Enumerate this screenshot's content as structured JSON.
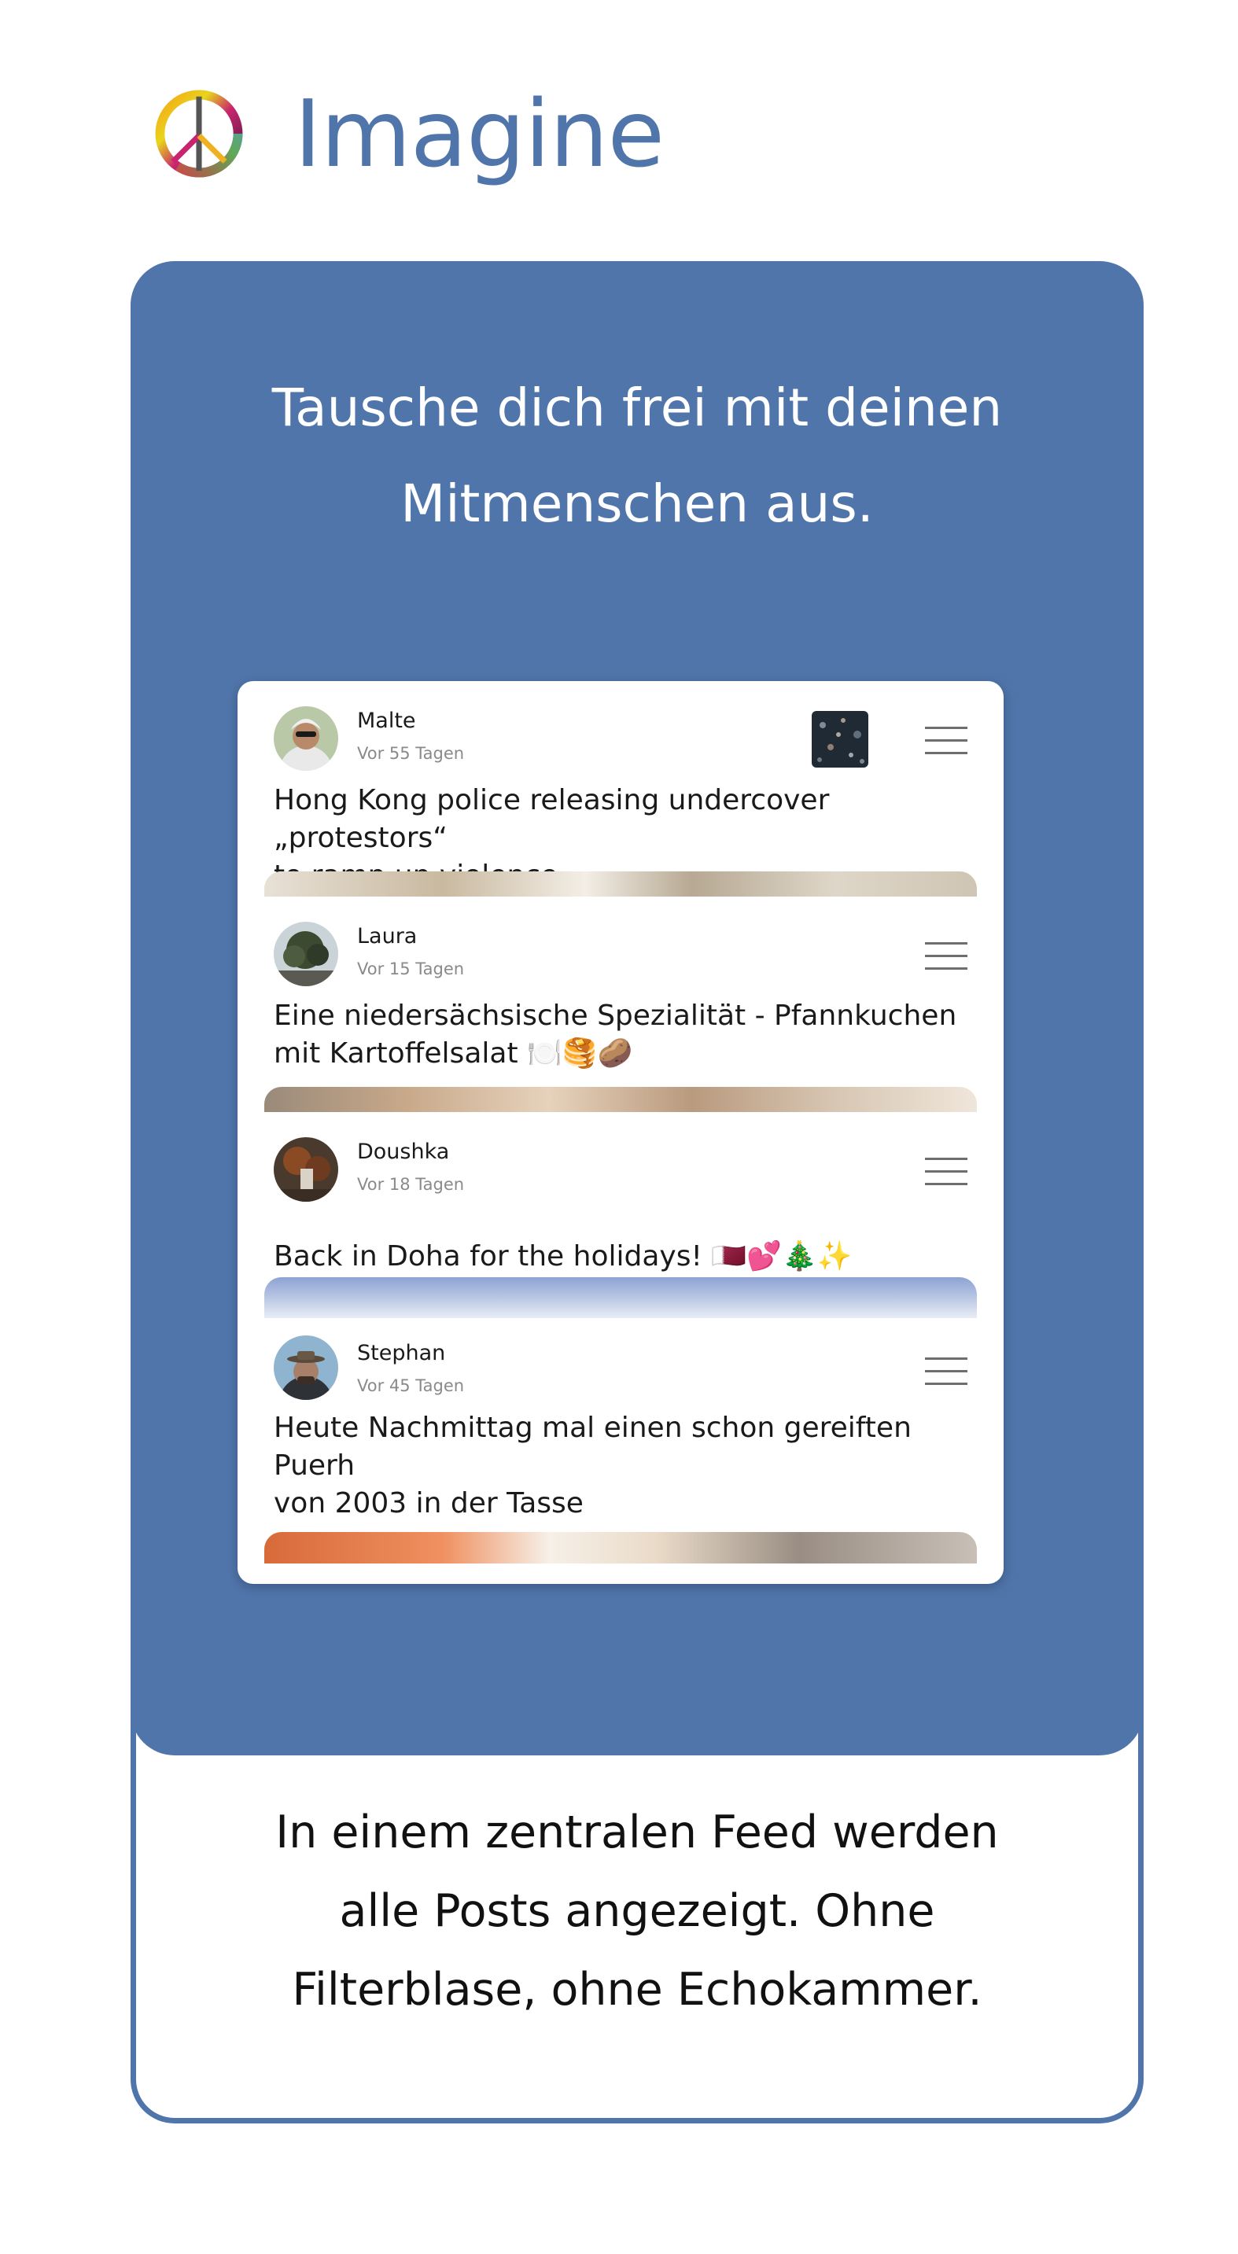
{
  "app": {
    "title": "Imagine"
  },
  "colors": {
    "brand": "#5075ab",
    "card_background": "#5075ab",
    "caption_text": "#111111"
  },
  "headline": {
    "line1": "Tausche dich frei mit deinen",
    "line2": "Mitmenschen aus."
  },
  "feed": {
    "posts": [
      {
        "author": "Malte",
        "time": "Vor 55 Tagen",
        "text_line1": "Hong Kong police releasing undercover „protestors“",
        "text_line2": "to ramp up violence",
        "avatar_icon": "person-sunglasses-avatar",
        "has_thumbnail": true
      },
      {
        "author": "Laura",
        "time": "Vor 15 Tagen",
        "text_line1": "Eine niedersächsische Spezialität - Pfannkuchen",
        "text_line2": "mit Kartoffelsalat 🍽️🥞🥔",
        "avatar_icon": "tree-avatar"
      },
      {
        "author": "Doushka",
        "time": "Vor 18 Tagen",
        "text_line1": "Back in Doha for the holidays! 🇶🇦💕🎄✨",
        "avatar_icon": "autumn-scene-avatar"
      },
      {
        "author": "Stephan",
        "time": "Vor 45 Tagen",
        "text_line1": "Heute Nachmittag mal einen schon gereiften Puerh",
        "text_line2": "von 2003 in der Tasse",
        "avatar_icon": "person-hat-avatar"
      }
    ]
  },
  "caption": {
    "line1": "In einem zentralen Feed werden",
    "line2": "alle Posts angezeigt. Ohne",
    "line3": "Filterblase, ohne Echokammer."
  }
}
